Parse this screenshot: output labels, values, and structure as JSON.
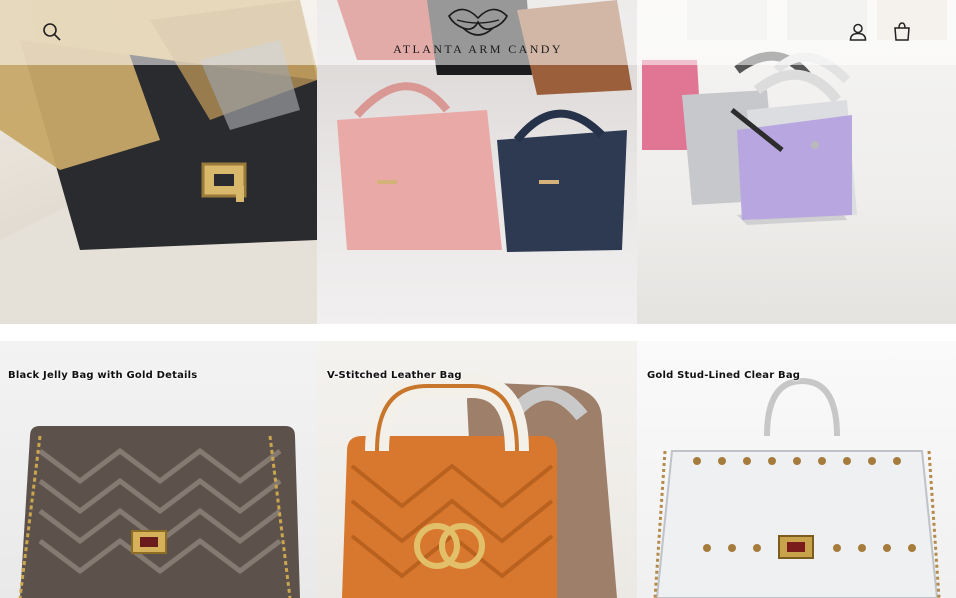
{
  "header": {
    "brand_name": "ATLANTA ARM CANDY",
    "icons": {
      "search": "search-icon",
      "account": "user-icon",
      "cart": "cart-icon"
    }
  },
  "hero": {
    "panels": [
      "hero-gold-croc-bag",
      "hero-pebbled-tote-bags",
      "hero-quilted-scarf-bags"
    ]
  },
  "products": {
    "items": [
      {
        "title": "Black Jelly Bag with Gold Details"
      },
      {
        "title": "V-Stitched Leather Bag"
      },
      {
        "title": "Gold Stud-Lined Clear Bag"
      }
    ]
  }
}
